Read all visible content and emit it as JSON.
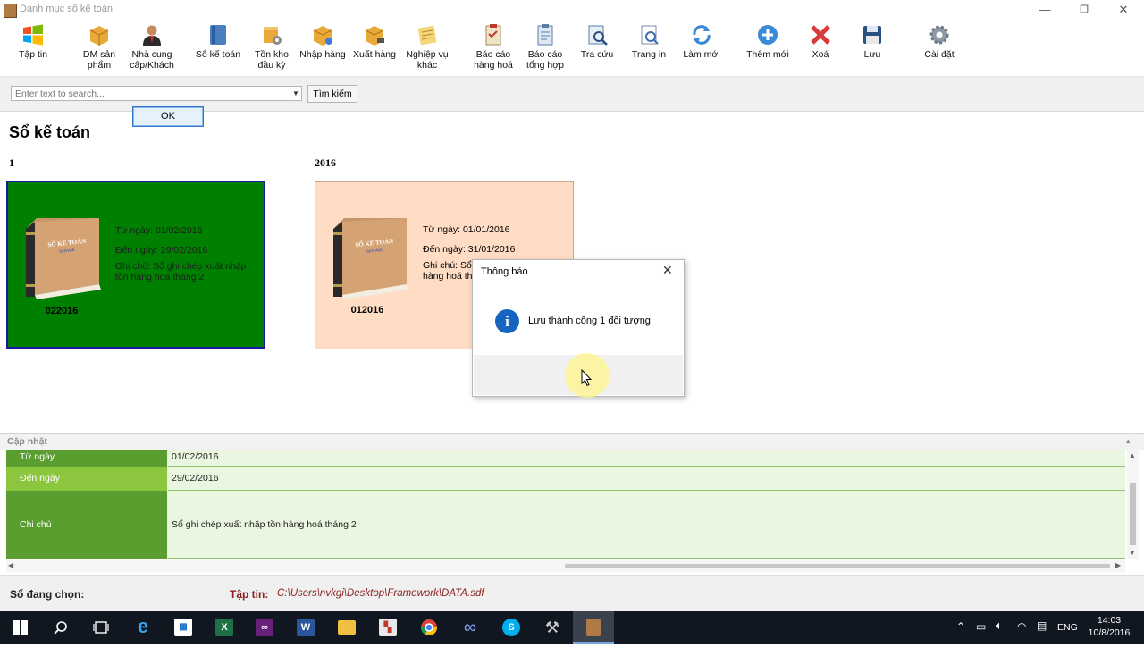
{
  "window": {
    "title": "Danh mục sổ kế toán",
    "minimize": "—",
    "restore": "❐",
    "close": "✕"
  },
  "ribbon": [
    {
      "label": "Tập tin",
      "icon": "windows-logo-icon"
    },
    {
      "label": "DM sản phẩm",
      "icon": "box-icon"
    },
    {
      "label": "Nhà cung cấp/Khách",
      "icon": "person-icon"
    },
    {
      "label": "Sổ kế toán",
      "icon": "ledger-icon"
    },
    {
      "label": "Tồn kho đầu kỳ",
      "icon": "inventory-gear-icon"
    },
    {
      "label": "Nhập hàng",
      "icon": "box-in-icon"
    },
    {
      "label": "Xuất hàng",
      "icon": "box-cart-icon"
    },
    {
      "label": "Nghiệp vụ khác",
      "icon": "notepad-icon"
    },
    {
      "label": "Báo cáo hàng hoá",
      "icon": "report-icon"
    },
    {
      "label": "Báo cáo tổng hợp",
      "icon": "clipboard-icon"
    },
    {
      "label": "Tra cứu",
      "icon": "lookup-icon"
    },
    {
      "label": "Trang in",
      "icon": "print-preview-icon"
    },
    {
      "label": "Làm mới",
      "icon": "refresh-icon"
    },
    {
      "label": "Thêm mới",
      "icon": "add-icon"
    },
    {
      "label": "Xoá",
      "icon": "delete-x-icon"
    },
    {
      "label": "Lưu",
      "icon": "floppy-save-icon"
    },
    {
      "label": "Cài đặt",
      "icon": "gear-icon"
    }
  ],
  "search": {
    "placeholder": "Enter text to search...",
    "button": "Tìm kiếm"
  },
  "page_title": "Sổ kế toán",
  "groups": [
    {
      "title": "1",
      "card": {
        "code": "022016",
        "from": "Từ ngày: 01/02/2016",
        "to": "Đến ngày: 29/02/2016",
        "note": "Ghi chú: Sổ ghi chép xuất nhập tồn hàng hoá tháng 2",
        "bg": "#008000",
        "selected": true
      }
    },
    {
      "title": "2016",
      "card": {
        "code": "012016",
        "from": "Từ ngày: 01/01/2016",
        "to": "Đến ngày: 31/01/2016",
        "note": "Ghi chú: Sổ g",
        "note2": "hàng hoá th",
        "bg": "#ffdcc4",
        "selected": false
      }
    }
  ],
  "book_cover": {
    "title": "SỔ KẾ TOÁN",
    "sub": "SKNVAK"
  },
  "dialog": {
    "title": "Thông báo",
    "message": "Lưu thành công 1 đối tượng",
    "ok": "OK",
    "icon": "info-icon",
    "close": "✕"
  },
  "update_panel": {
    "title": "Cập nhật",
    "pin": "▴",
    "rows": [
      {
        "label": "Từ ngày",
        "value": "01/02/2016"
      },
      {
        "label": "Đến ngày",
        "value": "29/02/2016"
      },
      {
        "label": "Chi chú",
        "value": "Sổ ghi chép xuất nhập tồn hàng hoá tháng 2"
      }
    ]
  },
  "status": {
    "selected_label": "Sổ đang chọn:",
    "file_label": "Tập tin:",
    "file_path": "C:\\Users\\nvkgi\\Desktop\\Framework\\DATA.sdf"
  },
  "taskbar": {
    "apps": [
      "start-icon",
      "search-icon",
      "task-view-icon",
      "edge-icon",
      "store-icon",
      "excel-icon",
      "visual-studio-icon",
      "word-icon",
      "file-explorer-icon",
      "app-icon",
      "chrome-icon",
      "infinity-app-icon",
      "skype-icon",
      "tools-icon",
      "ledger-app-icon"
    ],
    "lang": "ENG",
    "time": "14:03",
    "date": "10/8/2016"
  },
  "colors": {
    "card_selected": "#008000",
    "card_normal": "#ffdcc4",
    "grid_label_dark": "#5a9e2f",
    "grid_label_light": "#8cc63f",
    "status_text": "#8b2020"
  }
}
